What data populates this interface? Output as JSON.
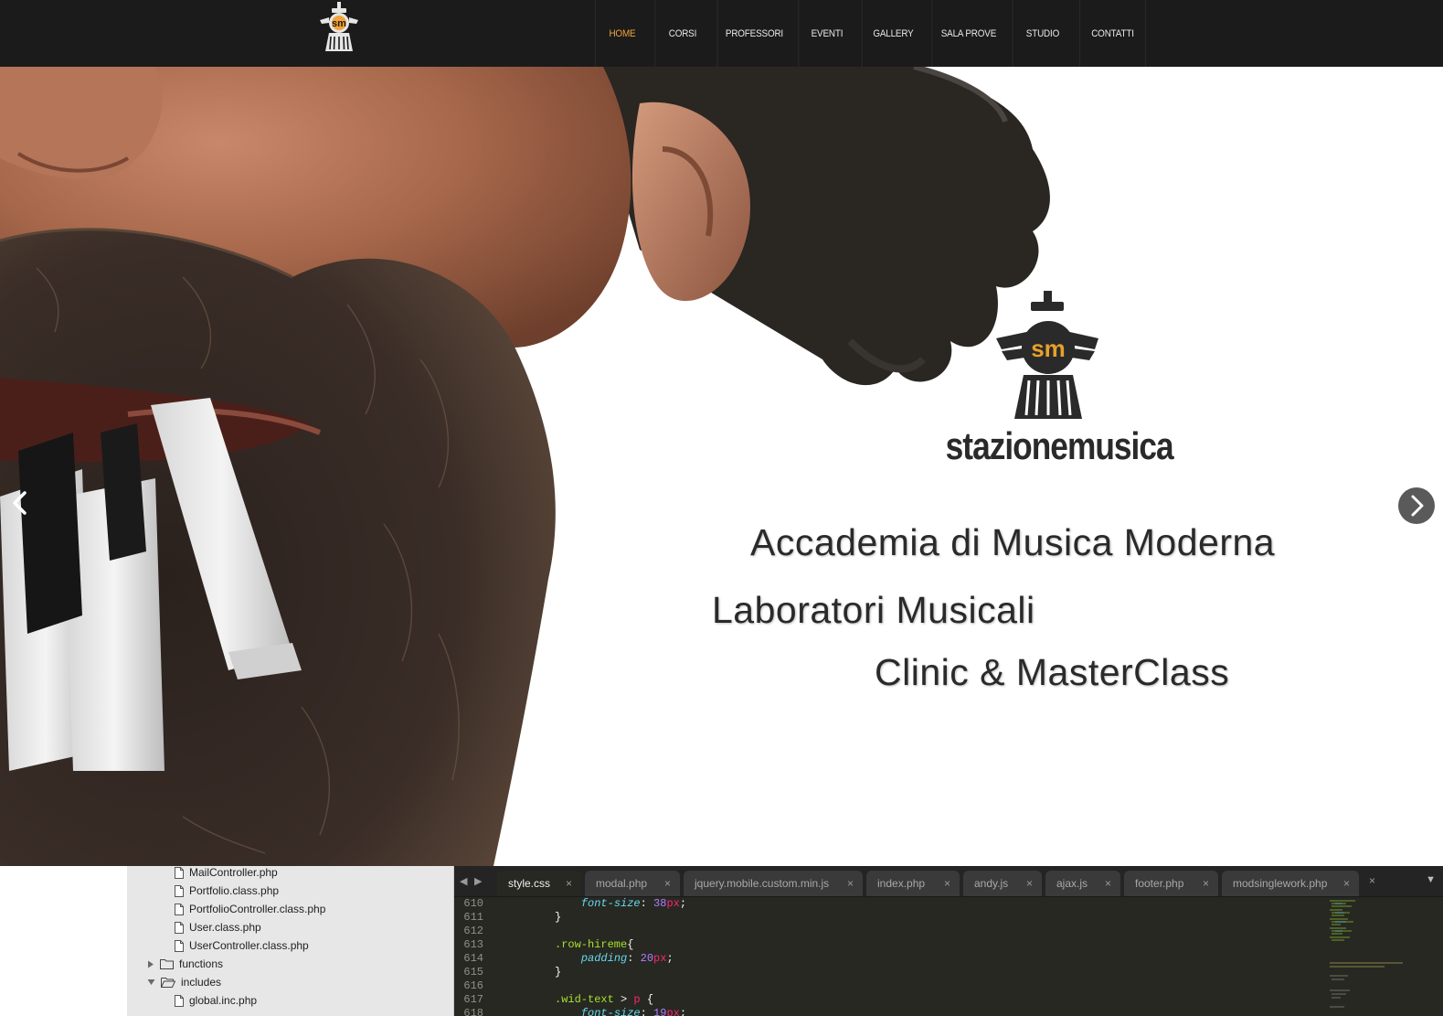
{
  "nav": {
    "items": [
      {
        "label": "HOME",
        "active": true
      },
      {
        "label": "CORSI"
      },
      {
        "label": "PROFESSORI"
      },
      {
        "label": "EVENTI"
      },
      {
        "label": "GALLERY"
      },
      {
        "label": "SALA PROVE"
      },
      {
        "label": "STUDIO"
      },
      {
        "label": "CONTATTI"
      }
    ],
    "active_color": "#f2a33a"
  },
  "hero": {
    "logo_monogram": "sm",
    "logo_wordmark": "stazionemusica",
    "taglines": [
      "Accademia di Musica Moderna",
      "Laboratori Musicali",
      "Clinic & MasterClass"
    ],
    "accent_color": "#e8a02c",
    "prev_icon": "chevron-left-icon",
    "next_icon": "chevron-right-icon"
  },
  "sidebar": {
    "rows": [
      {
        "label": "MailController.php",
        "type": "file"
      },
      {
        "label": "Portfolio.class.php",
        "type": "file"
      },
      {
        "label": "PortfolioController.class.php",
        "type": "file"
      },
      {
        "label": "User.class.php",
        "type": "file"
      },
      {
        "label": "UserController.class.php",
        "type": "file"
      },
      {
        "label": "functions",
        "type": "folder-closed"
      },
      {
        "label": "includes",
        "type": "folder-open"
      },
      {
        "label": "global.inc.php",
        "type": "file"
      }
    ]
  },
  "editor": {
    "tabs": [
      {
        "label": "style.css",
        "active": true
      },
      {
        "label": "modal.php"
      },
      {
        "label": "jquery.mobile.custom.min.js"
      },
      {
        "label": "index.php"
      },
      {
        "label": "andy.js"
      },
      {
        "label": "ajax.js"
      },
      {
        "label": "footer.php"
      },
      {
        "label": "modsinglework.php"
      }
    ],
    "tab_close_glyph": "×",
    "tab_nav_prev": "◀",
    "tab_nav_next": "▶",
    "tab_menu_glyph": "▼",
    "line_numbers": [
      "610",
      "611",
      "612",
      "613",
      "614",
      "615",
      "616",
      "617",
      "618"
    ],
    "code": [
      {
        "tokens": [
          {
            "t": "    ",
            "c": ""
          },
          {
            "t": "font-size",
            "c": "prop"
          },
          {
            "t": ": ",
            "c": ""
          },
          {
            "t": "38",
            "c": "num"
          },
          {
            "t": "px",
            "c": "unit"
          },
          {
            "t": ";",
            "c": ""
          }
        ]
      },
      {
        "tokens": [
          {
            "t": "}",
            "c": ""
          }
        ]
      },
      {
        "tokens": []
      },
      {
        "tokens": [
          {
            "t": ".row-hireme",
            "c": "sel"
          },
          {
            "t": "{",
            "c": ""
          }
        ]
      },
      {
        "tokens": [
          {
            "t": "    ",
            "c": ""
          },
          {
            "t": "padding",
            "c": "prop"
          },
          {
            "t": ": ",
            "c": ""
          },
          {
            "t": "20",
            "c": "num"
          },
          {
            "t": "px",
            "c": "unit"
          },
          {
            "t": ";",
            "c": ""
          }
        ]
      },
      {
        "tokens": [
          {
            "t": "}",
            "c": ""
          }
        ]
      },
      {
        "tokens": []
      },
      {
        "tokens": [
          {
            "t": ".wid-text",
            "c": "sel"
          },
          {
            "t": " > ",
            "c": ""
          },
          {
            "t": "p",
            "c": "tag"
          },
          {
            "t": " {",
            "c": ""
          }
        ]
      },
      {
        "tokens": [
          {
            "t": "    ",
            "c": ""
          },
          {
            "t": "font-size",
            "c": "prop"
          },
          {
            "t": ": ",
            "c": ""
          },
          {
            "t": "19",
            "c": "num"
          },
          {
            "t": "px",
            "c": "unit"
          },
          {
            "t": ";",
            "c": ""
          }
        ]
      }
    ]
  }
}
